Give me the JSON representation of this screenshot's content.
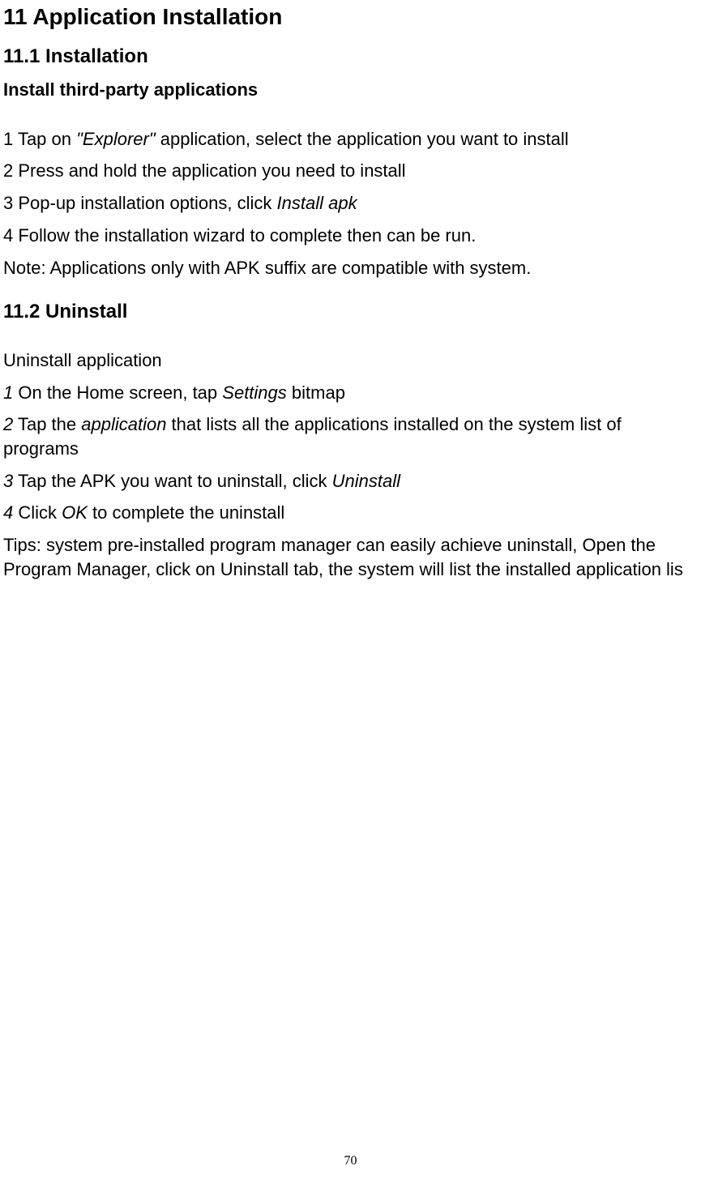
{
  "h1": "11 Application Installation",
  "h2a": "11.1 Installation",
  "h3a": "Install third-party applications",
  "s1": {
    "p1_a": "1 Tap on ",
    "p1_i": "\"Explorer\" ",
    "p1_b": "application, select the application you want to install",
    "p2": "2 Press and hold the application you need to install",
    "p3_a": "3 Pop-up installation options, click ",
    "p3_i": "Install apk",
    "p4": "4 Follow the installation wizard to complete then can be run.",
    "note": "Note: Applications only with APK suffix are compatible with system."
  },
  "h2b": "11.2 Uninstall",
  "s2": {
    "lead": "Uninstall application",
    "p1_n": "1",
    "p1_a": " On the Home screen, tap ",
    "p1_i": "Settings",
    "p1_b": " bitmap",
    "p2_n": "2",
    "p2_a": " Tap the ",
    "p2_i": "application",
    "p2_b": " that lists all the applications installed on the system list of programs",
    "p3_n": "3",
    "p3_a": " Tap the APK you want to uninstall, click ",
    "p3_i": "Uninstall",
    "p4_n": "4",
    "p4_a": " Click ",
    "p4_i": "OK",
    "p4_b": " to complete the uninstall",
    "tips": "Tips: system pre-installed program manager can easily achieve uninstall, Open the Program Manager, click on Uninstall tab, the system will list the installed application lis"
  },
  "page_number": "70"
}
